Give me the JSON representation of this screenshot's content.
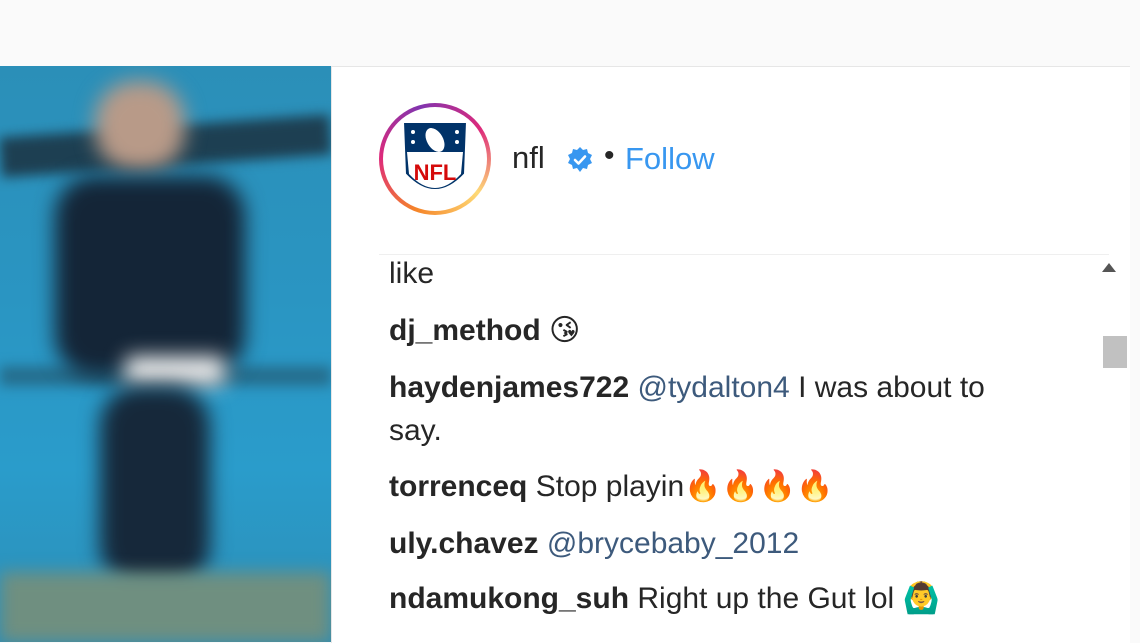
{
  "account": {
    "username": "nfl",
    "separator": "•",
    "follow_label": "Follow",
    "logo_text": "NFL"
  },
  "comments": [
    {
      "user": "",
      "mention": "",
      "text": "like"
    },
    {
      "user": "dj_method",
      "mention": "",
      "text": "😘"
    },
    {
      "user": "haydenjames722",
      "mention": "@tydalton4",
      "text": "I was about to say."
    },
    {
      "user": "torrenceq",
      "mention": "",
      "text": "Stop playin🔥🔥🔥🔥"
    },
    {
      "user": "uly.chavez",
      "mention": "@brycebaby_2012",
      "text": ""
    },
    {
      "user": "ndamukong_suh",
      "mention": "",
      "text": "Right up the Gut lol 🙆‍♂️"
    }
  ],
  "colors": {
    "link": "#3897f0",
    "verified": "#3897f0",
    "text": "#262626"
  },
  "icons": {
    "verified": "verified-badge-icon",
    "scroll_up": "chevron-up-icon"
  }
}
